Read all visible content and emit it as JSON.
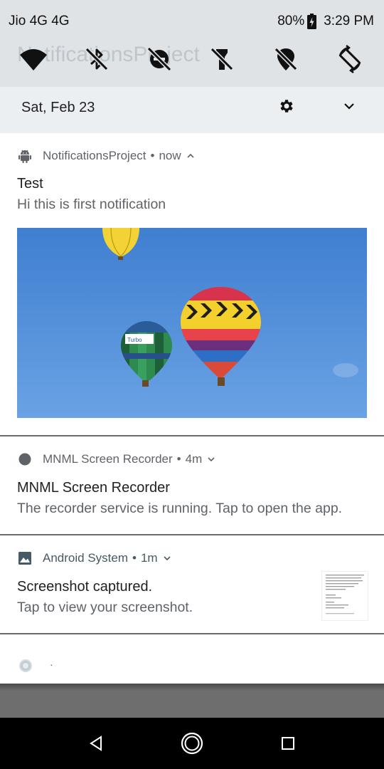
{
  "status_bar": {
    "carrier": "Jio 4G 4G",
    "battery_percent": "80%",
    "time": "3:29 PM"
  },
  "quick_settings": {
    "background_title": "NotificationsProject",
    "tiles": [
      "wifi-icon",
      "bluetooth-off-icon",
      "do-not-disturb-off-icon",
      "flashlight-off-icon",
      "location-off-icon",
      "auto-rotate-icon"
    ]
  },
  "date_row": {
    "date": "Sat, Feb 23"
  },
  "notifications": [
    {
      "app": "NotificationsProject",
      "time": "now",
      "title": "Test",
      "text": "Hi this is first notification",
      "icon": "android-icon",
      "expanded": true,
      "image": "hot-air-balloons-picture"
    },
    {
      "app": "MNML Screen Recorder",
      "time": "4m",
      "title": "MNML Screen Recorder",
      "text": "The recorder service is running. Tap to open the app.",
      "icon": "circle-icon"
    },
    {
      "app": "Android System",
      "time": "1m",
      "title": "Screenshot captured.",
      "text": "Tap to view your screenshot.",
      "icon": "image-icon",
      "thumbnail": "screenshot-thumbnail"
    },
    {
      "text": "·",
      "icon": "disc-icon"
    }
  ],
  "header_separator": "•",
  "colors": {
    "quick_settings_bg": "#dfe3e6",
    "date_row_bg": "#eceff1",
    "notification_bg": "#ffffff",
    "android_system_accent": "#455a64",
    "sky_blue": "#4a86d4",
    "nav_bar": "#000000"
  },
  "navigation": [
    "back-icon",
    "home-icon",
    "recents-icon"
  ]
}
